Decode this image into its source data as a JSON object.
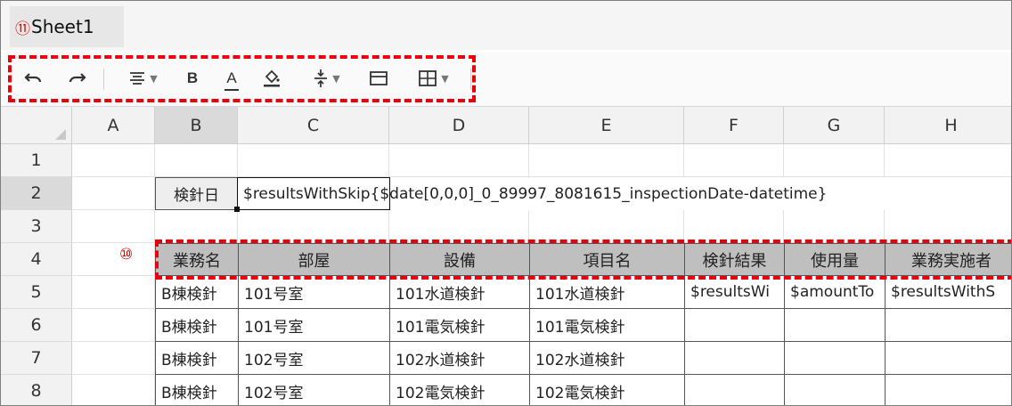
{
  "sheet_tab": {
    "marker": "⑪",
    "label": "Sheet1"
  },
  "toolbar_icons": [
    "undo-icon",
    "redo-icon",
    "align-icon",
    "bold-icon",
    "font-color-icon",
    "fill-color-icon",
    "vertical-align-icon",
    "merge-cells-icon",
    "borders-icon"
  ],
  "toolbar": {
    "bold": "B",
    "font_color": "A"
  },
  "columns": [
    "A",
    "B",
    "C",
    "D",
    "E",
    "F",
    "G",
    "H"
  ],
  "rows": [
    "1",
    "2",
    "3",
    "4",
    "5",
    "6",
    "7",
    "8"
  ],
  "marker10": "⑩",
  "cells": {
    "B2": "検針日",
    "C2": "$resultsWithSkip{$date[0,0,0]_0_89997_8081615_inspectionDate-datetime}",
    "header": [
      "業務名",
      "部屋",
      "設備",
      "項目名",
      "検針結果",
      "使用量",
      "業務実施者"
    ],
    "data": [
      [
        "B棟検針",
        "101号室",
        "101水道検針",
        "101水道検針",
        "$resultsWi",
        "$amountTo",
        "$resultsWithS"
      ],
      [
        "B棟検針",
        "101号室",
        "101電気検針",
        "101電気検針",
        "",
        "",
        ""
      ],
      [
        "B棟検針",
        "102号室",
        "102水道検針",
        "102水道検針",
        "",
        "",
        ""
      ],
      [
        "B棟検針",
        "102号室",
        "102電気検針",
        "102電気検針",
        "",
        "",
        ""
      ]
    ]
  },
  "colors": {
    "highlight_dash": "#e8000b",
    "header_fill": "#bfbfbf"
  }
}
